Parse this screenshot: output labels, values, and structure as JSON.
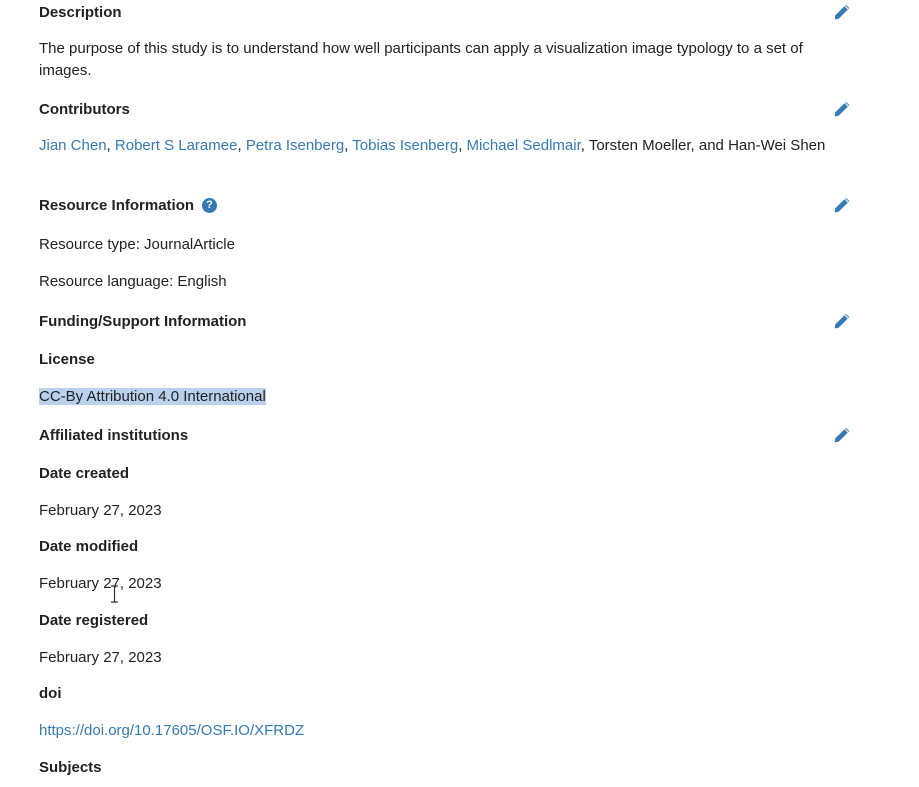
{
  "description": {
    "label": "Description",
    "text": "The purpose of this study is to understand how well participants can apply a visualization image typology to a set of images."
  },
  "contributors": {
    "label": "Contributors",
    "linked": [
      "Jian Chen",
      "Robert S Laramee",
      "Petra Isenberg",
      "Tobias Isenberg",
      "Michael Sedlmair"
    ],
    "sep": ", ",
    "plain_tail": ", Torsten Moeller, and Han-Wei Shen"
  },
  "resource": {
    "label": "Resource Information",
    "help_glyph": "?",
    "type_text": "Resource type: JournalArticle",
    "language_text": "Resource language: English"
  },
  "funding": {
    "label": "Funding/Support Information"
  },
  "license": {
    "label": "License",
    "value": "CC-By Attribution 4.0 International"
  },
  "affiliated": {
    "label": "Affiliated institutions"
  },
  "date_created": {
    "label": "Date created",
    "value": "February 27, 2023"
  },
  "date_modified": {
    "label": "Date modified",
    "value": "February 27, 2023"
  },
  "date_registered": {
    "label": "Date registered",
    "value": "February 27, 2023"
  },
  "doi": {
    "label": "doi",
    "value": "https://doi.org/10.17605/OSF.IO/XFRDZ"
  },
  "subjects": {
    "label": "Subjects"
  },
  "colors": {
    "link": "#337ab7",
    "highlight": "#b9d1ec",
    "text": "#222222"
  },
  "icons": {
    "edit": "pencil-icon",
    "help": "question-circle-icon",
    "cursor": "text-cursor-icon"
  }
}
